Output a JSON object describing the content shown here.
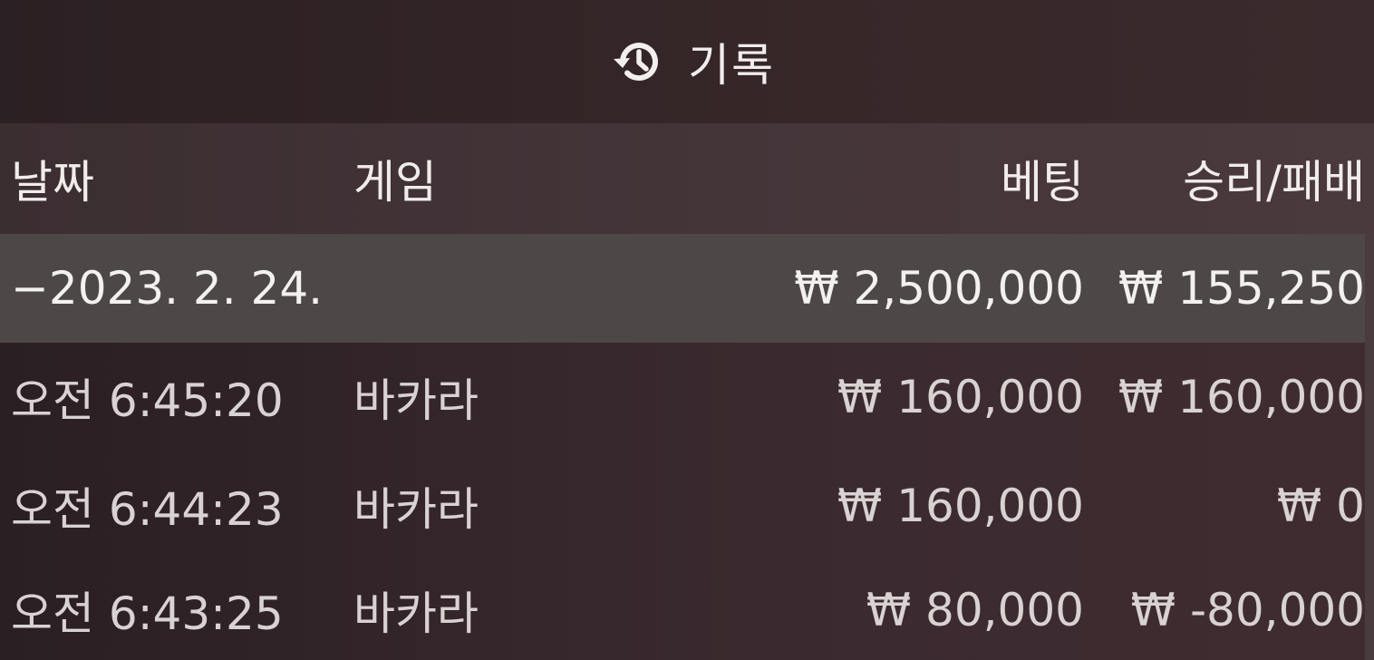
{
  "header": {
    "title": "기록",
    "icon": "history-icon"
  },
  "columns": {
    "date": "날짜",
    "game": "게임",
    "bet": "베팅",
    "result": "승리/패배"
  },
  "summary": {
    "date": "−2023. 2. 24.",
    "bet": "₩ 2,500,000",
    "result": "₩ 155,250"
  },
  "rows": [
    {
      "time": "오전 6:45:20",
      "game": "바카라",
      "bet": "₩ 160,000",
      "result": "₩ 160,000"
    },
    {
      "time": "오전 6:44:23",
      "game": "바카라",
      "bet": "₩ 160,000",
      "result": "₩ 0"
    },
    {
      "time": "오전 6:43:25",
      "game": "바카라",
      "bet": "₩ 80,000",
      "result": "₩ -80,000"
    }
  ],
  "colors": {
    "background": "#2e2226",
    "summary_row": "#4e4748",
    "text": "#e9e4e5"
  }
}
